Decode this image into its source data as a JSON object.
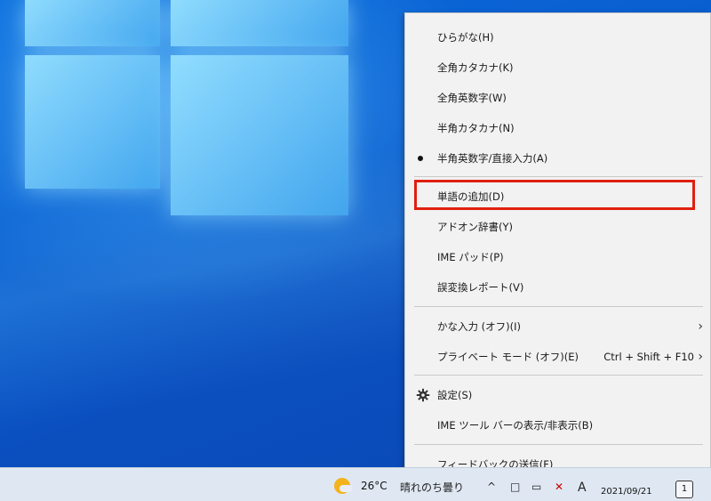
{
  "menu": {
    "items": [
      {
        "label": "ひらがな(H)"
      },
      {
        "label": "全角カタカナ(K)"
      },
      {
        "label": "全角英数字(W)"
      },
      {
        "label": "半角カタカナ(N)"
      },
      {
        "label": "半角英数字/直接入力(A)",
        "selected": true
      },
      {
        "label": "単語の追加(D)",
        "highlighted": true
      },
      {
        "label": "アドオン辞書(Y)"
      },
      {
        "label": "IME パッド(P)"
      },
      {
        "label": "誤変換レポート(V)"
      },
      {
        "label": "かな入力 (オフ)(I)",
        "submenu": true
      },
      {
        "label": "プライベート モード (オフ)(E)",
        "shortcut": "Ctrl + Shift + F10",
        "submenu": true
      },
      {
        "label": "設定(S)",
        "icon": "gear-icon"
      },
      {
        "label": "IME ツール バーの表示/非表示(B)"
      },
      {
        "label": "フィードバックの送信(F)"
      }
    ],
    "highlight_color": "#e02010"
  },
  "taskbar": {
    "temperature": "26°C",
    "weather_text": "晴れのち曇り",
    "ime_indicator": "A",
    "date": "2021/09/21",
    "notification_count": "1"
  }
}
